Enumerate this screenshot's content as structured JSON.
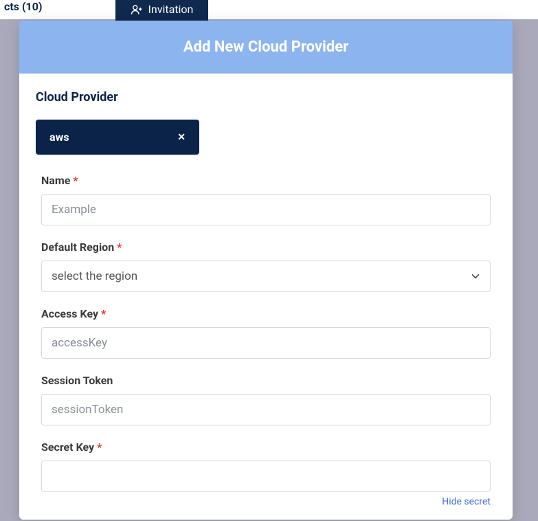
{
  "background": {
    "nav_text": "cts (10)",
    "invitation_label": "Invitation"
  },
  "modal": {
    "title": "Add New Cloud Provider",
    "section_title": "Cloud Provider",
    "provider_tag": {
      "label": "aws",
      "remove_symbol": "✕"
    },
    "fields": {
      "name": {
        "label": "Name",
        "required": "*",
        "placeholder": "Example",
        "value": ""
      },
      "region": {
        "label": "Default Region",
        "required": "*",
        "placeholder": "select the region",
        "value": ""
      },
      "access_key": {
        "label": "Access Key",
        "required": "*",
        "placeholder": "accessKey",
        "value": ""
      },
      "session_token": {
        "label": "Session Token",
        "required": "",
        "placeholder": "sessionToken",
        "value": ""
      },
      "secret_key": {
        "label": "Secret Key",
        "required": "*",
        "placeholder": "",
        "value": ""
      }
    },
    "hide_secret_label": "Hide secret"
  }
}
